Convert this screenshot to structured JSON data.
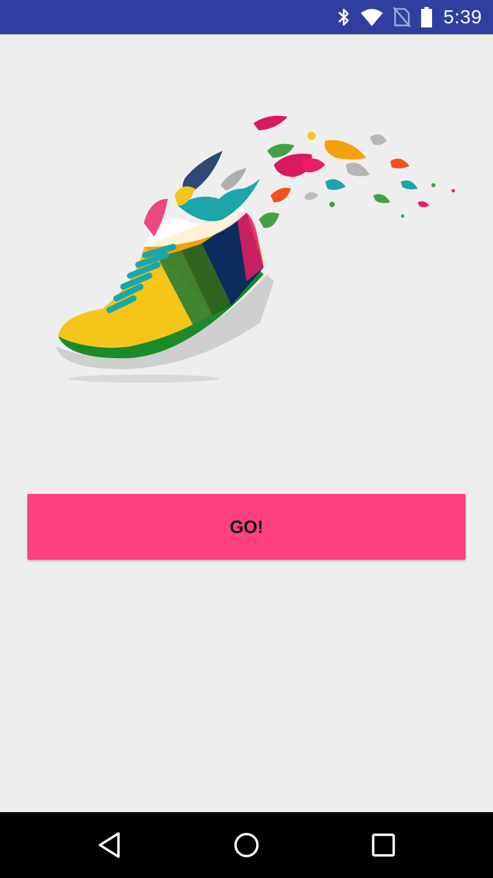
{
  "status_bar": {
    "time": "5:39",
    "icons": [
      "bluetooth-icon",
      "wifi-icon",
      "no-sim-icon",
      "battery-icon"
    ],
    "background_color": "#303F9F"
  },
  "main": {
    "hero_image": "running-shoe-illustration",
    "go_button": {
      "label": "GO!",
      "color": "#FF4081"
    }
  },
  "nav_bar": {
    "buttons": [
      "back-icon",
      "home-icon",
      "recents-icon"
    ]
  }
}
